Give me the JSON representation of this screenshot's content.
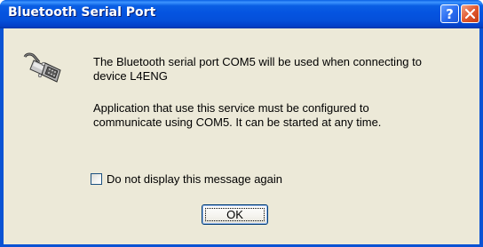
{
  "window": {
    "title": "Bluetooth Serial Port"
  },
  "icons": {
    "help": "help-icon",
    "close": "close-icon",
    "app": "serial-port-icon"
  },
  "colors": {
    "titlebar": "#0554E0",
    "client": "#ECE9D8",
    "close_button": "#E2582E"
  },
  "message": {
    "paragraph1": [
      "The Bluetooth serial port COM5 will be used when connecting to",
      "device L4ENG"
    ],
    "paragraph2": [
      "Application that use this service must be configured to",
      "communicate using COM5.  It can be started at any time."
    ]
  },
  "checkbox": {
    "label": "Do not display this message again",
    "checked": false
  },
  "buttons": {
    "ok": "OK"
  }
}
